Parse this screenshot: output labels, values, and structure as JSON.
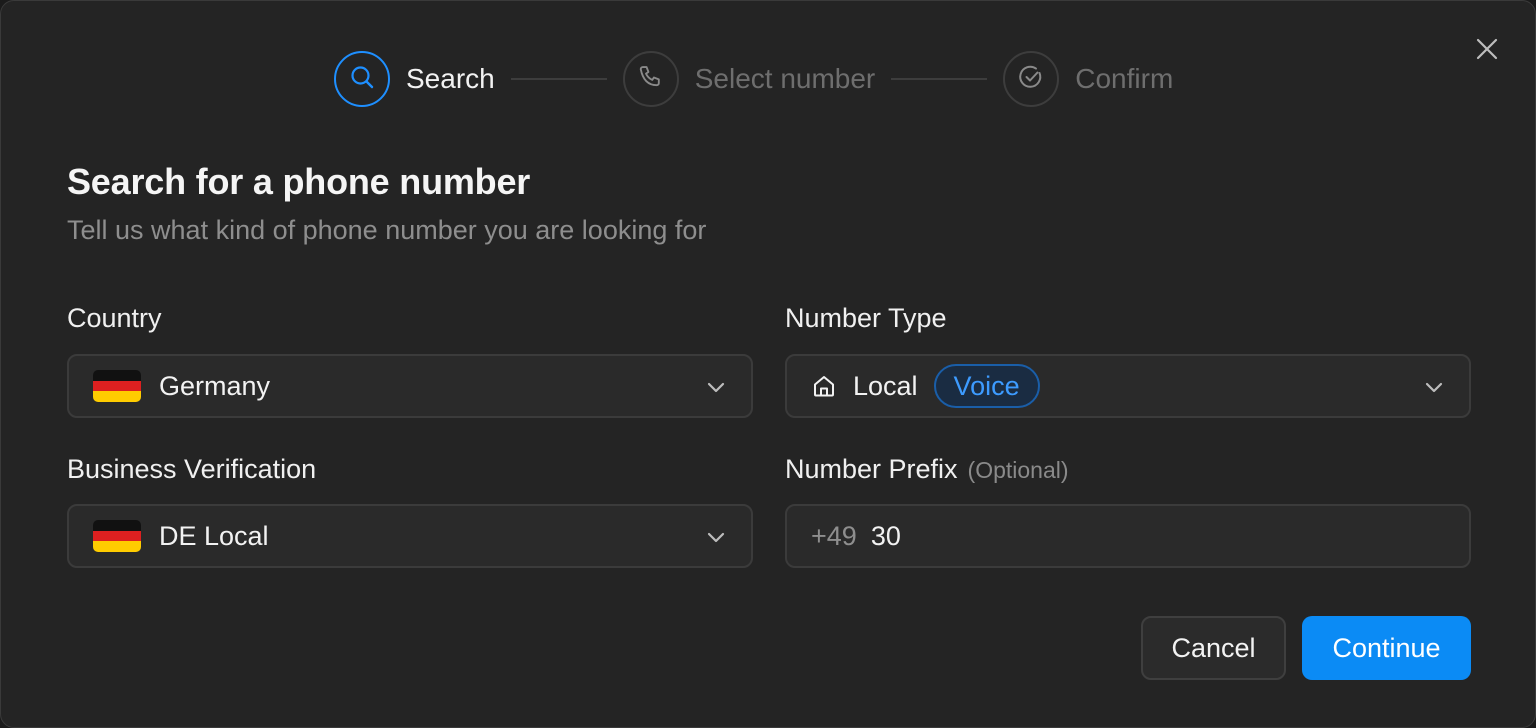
{
  "stepper": {
    "steps": [
      {
        "label": "Search",
        "icon": "search-icon",
        "state": "active"
      },
      {
        "label": "Select number",
        "icon": "phone-icon",
        "state": "inactive"
      },
      {
        "label": "Confirm",
        "icon": "check-circle-icon",
        "state": "inactive"
      }
    ]
  },
  "header": {
    "title": "Search for a phone number",
    "subtitle": "Tell us what kind of phone number you are looking for"
  },
  "form": {
    "country": {
      "label": "Country",
      "value": "Germany",
      "flag": "de-flag"
    },
    "number_type": {
      "label": "Number Type",
      "value": "Local",
      "badge": "Voice",
      "icon": "home-icon"
    },
    "business_verification": {
      "label": "Business Verification",
      "value": "DE Local",
      "flag": "de-flag"
    },
    "number_prefix": {
      "label": "Number Prefix",
      "optional": "(Optional)",
      "country_code": "+49",
      "value": "30"
    }
  },
  "actions": {
    "cancel": "Cancel",
    "continue": "Continue"
  },
  "colors": {
    "accent": "#0b8bf5",
    "background": "#242424",
    "border": "#3b3b3b"
  }
}
